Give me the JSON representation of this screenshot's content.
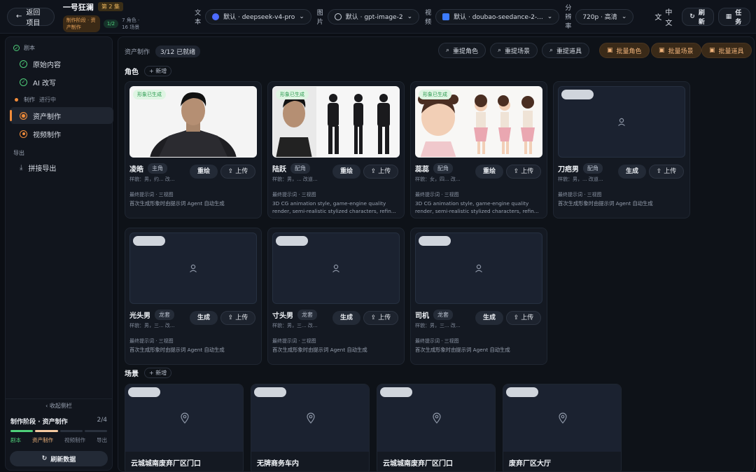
{
  "header": {
    "back": "返回项目",
    "project": "一号狂澜",
    "episode": "第 2 集",
    "stage": "制作阶段 · 资产制作",
    "progress": "1/2",
    "counts": "7 角色 · 16 场景",
    "text_label": "文本",
    "text_model": "默认 · deepseek-v4-pro",
    "image_label": "图片",
    "image_model": "默认 · gpt-image-2",
    "video_label": "视频",
    "video_model": "默认 · doubao-seedance-2-...",
    "res_label": "分辨率",
    "res_value": "720p · 高清",
    "lang": "中文",
    "refresh": "刷新",
    "tasks": "任务"
  },
  "sidebar": {
    "sec1": "剧本",
    "item1": "原始内容",
    "item2": "AI 改写",
    "sec2": "制作",
    "sec2_status": "进行中",
    "item3": "资产制作",
    "item4": "视频制作",
    "sec3": "导出",
    "item5": "拼接导出",
    "collapse": "收起侧栏",
    "stage_title": "制作阶段 · 资产制作",
    "stage_count": "2/4",
    "s1": "剧本",
    "s2": "资产制作",
    "s3": "视频制作",
    "s4": "导出",
    "refresh_data": "刷新数据"
  },
  "toolbar": {
    "label": "资产制作",
    "ready": "3/12 已就绪",
    "b1": "重提角色",
    "b2": "重提场景",
    "b3": "重提道具",
    "b4": "批量角色",
    "b5": "批量场景",
    "b6": "批量道具"
  },
  "roles": {
    "title": "角色",
    "add": "新增"
  },
  "scenes": {
    "title": "场景",
    "add": "新增"
  },
  "characters": [
    {
      "name": "凌皓",
      "role": "主角",
      "meta": "样貌：男，约...  改...",
      "btn": "重绘",
      "upload": "上传",
      "badge": "形象已生成",
      "plabel": "最终提示词 · 三视图",
      "ptext": "首次生成形象时由提示词 Agent 自动生成"
    },
    {
      "name": "陆跃",
      "role": "配角",
      "meta": "样貌：男，...  改道...",
      "btn": "重绘",
      "upload": "上传",
      "badge": "形象已生成",
      "plabel": "最终提示词 · 三视图",
      "ptext": "3D CG animation style, game-engine quality render, semi-realistic stylized characters, refin..."
    },
    {
      "name": "蕊蕊",
      "role": "配角",
      "meta": "样貌：女，四...  改...",
      "btn": "重绘",
      "upload": "上传",
      "badge": "形象已生成",
      "plabel": "最终提示词 · 三视图",
      "ptext": "3D CG animation style, game-engine quality render, semi-realistic stylized characters, refin..."
    },
    {
      "name": "刀疤男",
      "role": "配角",
      "meta": "样貌：男，...  改道...",
      "btn": "生成",
      "upload": "上传",
      "badge": "",
      "plabel": "最终提示词 · 三视图",
      "ptext": "首次生成形象时由提示词 Agent 自动生成"
    },
    {
      "name": "光头男",
      "role": "龙套",
      "meta": "样貌：男，三...  改...",
      "btn": "生成",
      "upload": "上传",
      "badge": "",
      "plabel": "最终提示词 · 三视图",
      "ptext": "首次生成形象时由提示词 Agent 自动生成"
    },
    {
      "name": "寸头男",
      "role": "龙套",
      "meta": "样貌：男，三...  改...",
      "btn": "生成",
      "upload": "上传",
      "badge": "",
      "plabel": "最终提示词 · 三视图",
      "ptext": "首次生成形象时由提示词 Agent 自动生成"
    },
    {
      "name": "司机",
      "role": "龙套",
      "meta": "样貌：男，三...  改...",
      "btn": "生成",
      "upload": "上传",
      "badge": "",
      "plabel": "最终提示词 · 三视图",
      "ptext": "首次生成形象时由提示词 Agent 自动生成"
    }
  ],
  "scene_list": [
    "云城城南废弃厂区门口",
    "无牌商务车内",
    "云城城南废弃厂区门口",
    "废弃厂区大厅"
  ],
  "colors": {
    "accent": "#f28c3a",
    "success": "#4fd07a",
    "bg": "#0b0e14"
  }
}
